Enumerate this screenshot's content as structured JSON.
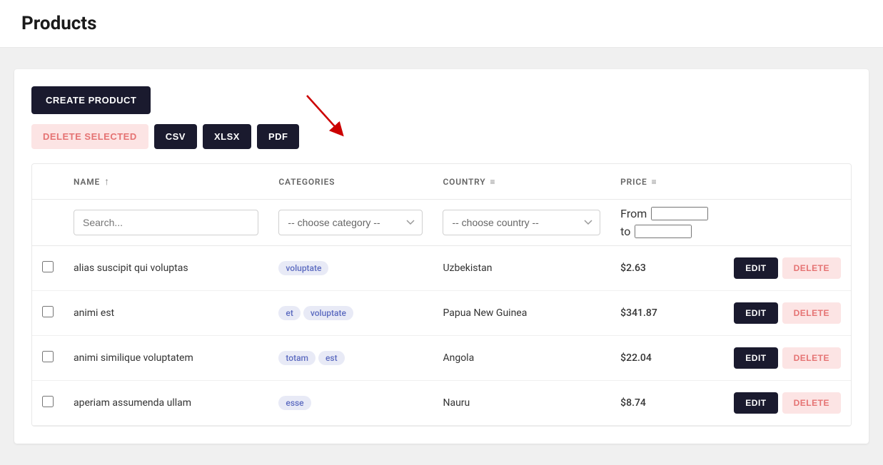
{
  "header": {
    "title": "Products"
  },
  "toolbar": {
    "create_label": "CREATE PRODUCT",
    "delete_selected_label": "DELETE SELECTED",
    "csv_label": "CSV",
    "xlsx_label": "XLSX",
    "pdf_label": "PDF"
  },
  "table": {
    "columns": {
      "name": "NAME",
      "categories": "CATEGORIES",
      "country": "COUNTRY",
      "price": "PRICE"
    },
    "filters": {
      "search_placeholder": "Search...",
      "category_placeholder": "-- choose category --",
      "country_placeholder": "-- choose country --",
      "price_from_label": "From",
      "price_to_label": "to"
    },
    "rows": [
      {
        "name": "alias suscipit qui voluptas",
        "tags": [
          "voluptate"
        ],
        "country": "Uzbekistan",
        "price": "$2.63"
      },
      {
        "name": "animi est",
        "tags": [
          "et",
          "voluptate"
        ],
        "country": "Papua New Guinea",
        "price": "$341.87"
      },
      {
        "name": "animi similique voluptatem",
        "tags": [
          "totam",
          "est"
        ],
        "country": "Angola",
        "price": "$22.04"
      },
      {
        "name": "aperiam assumenda ullam",
        "tags": [
          "esse"
        ],
        "country": "Nauru",
        "price": "$8.74"
      }
    ],
    "edit_label": "EDIT",
    "delete_label": "DELETE"
  },
  "icons": {
    "sort_asc": "↑",
    "filter": "≡",
    "chevron": "▾"
  }
}
